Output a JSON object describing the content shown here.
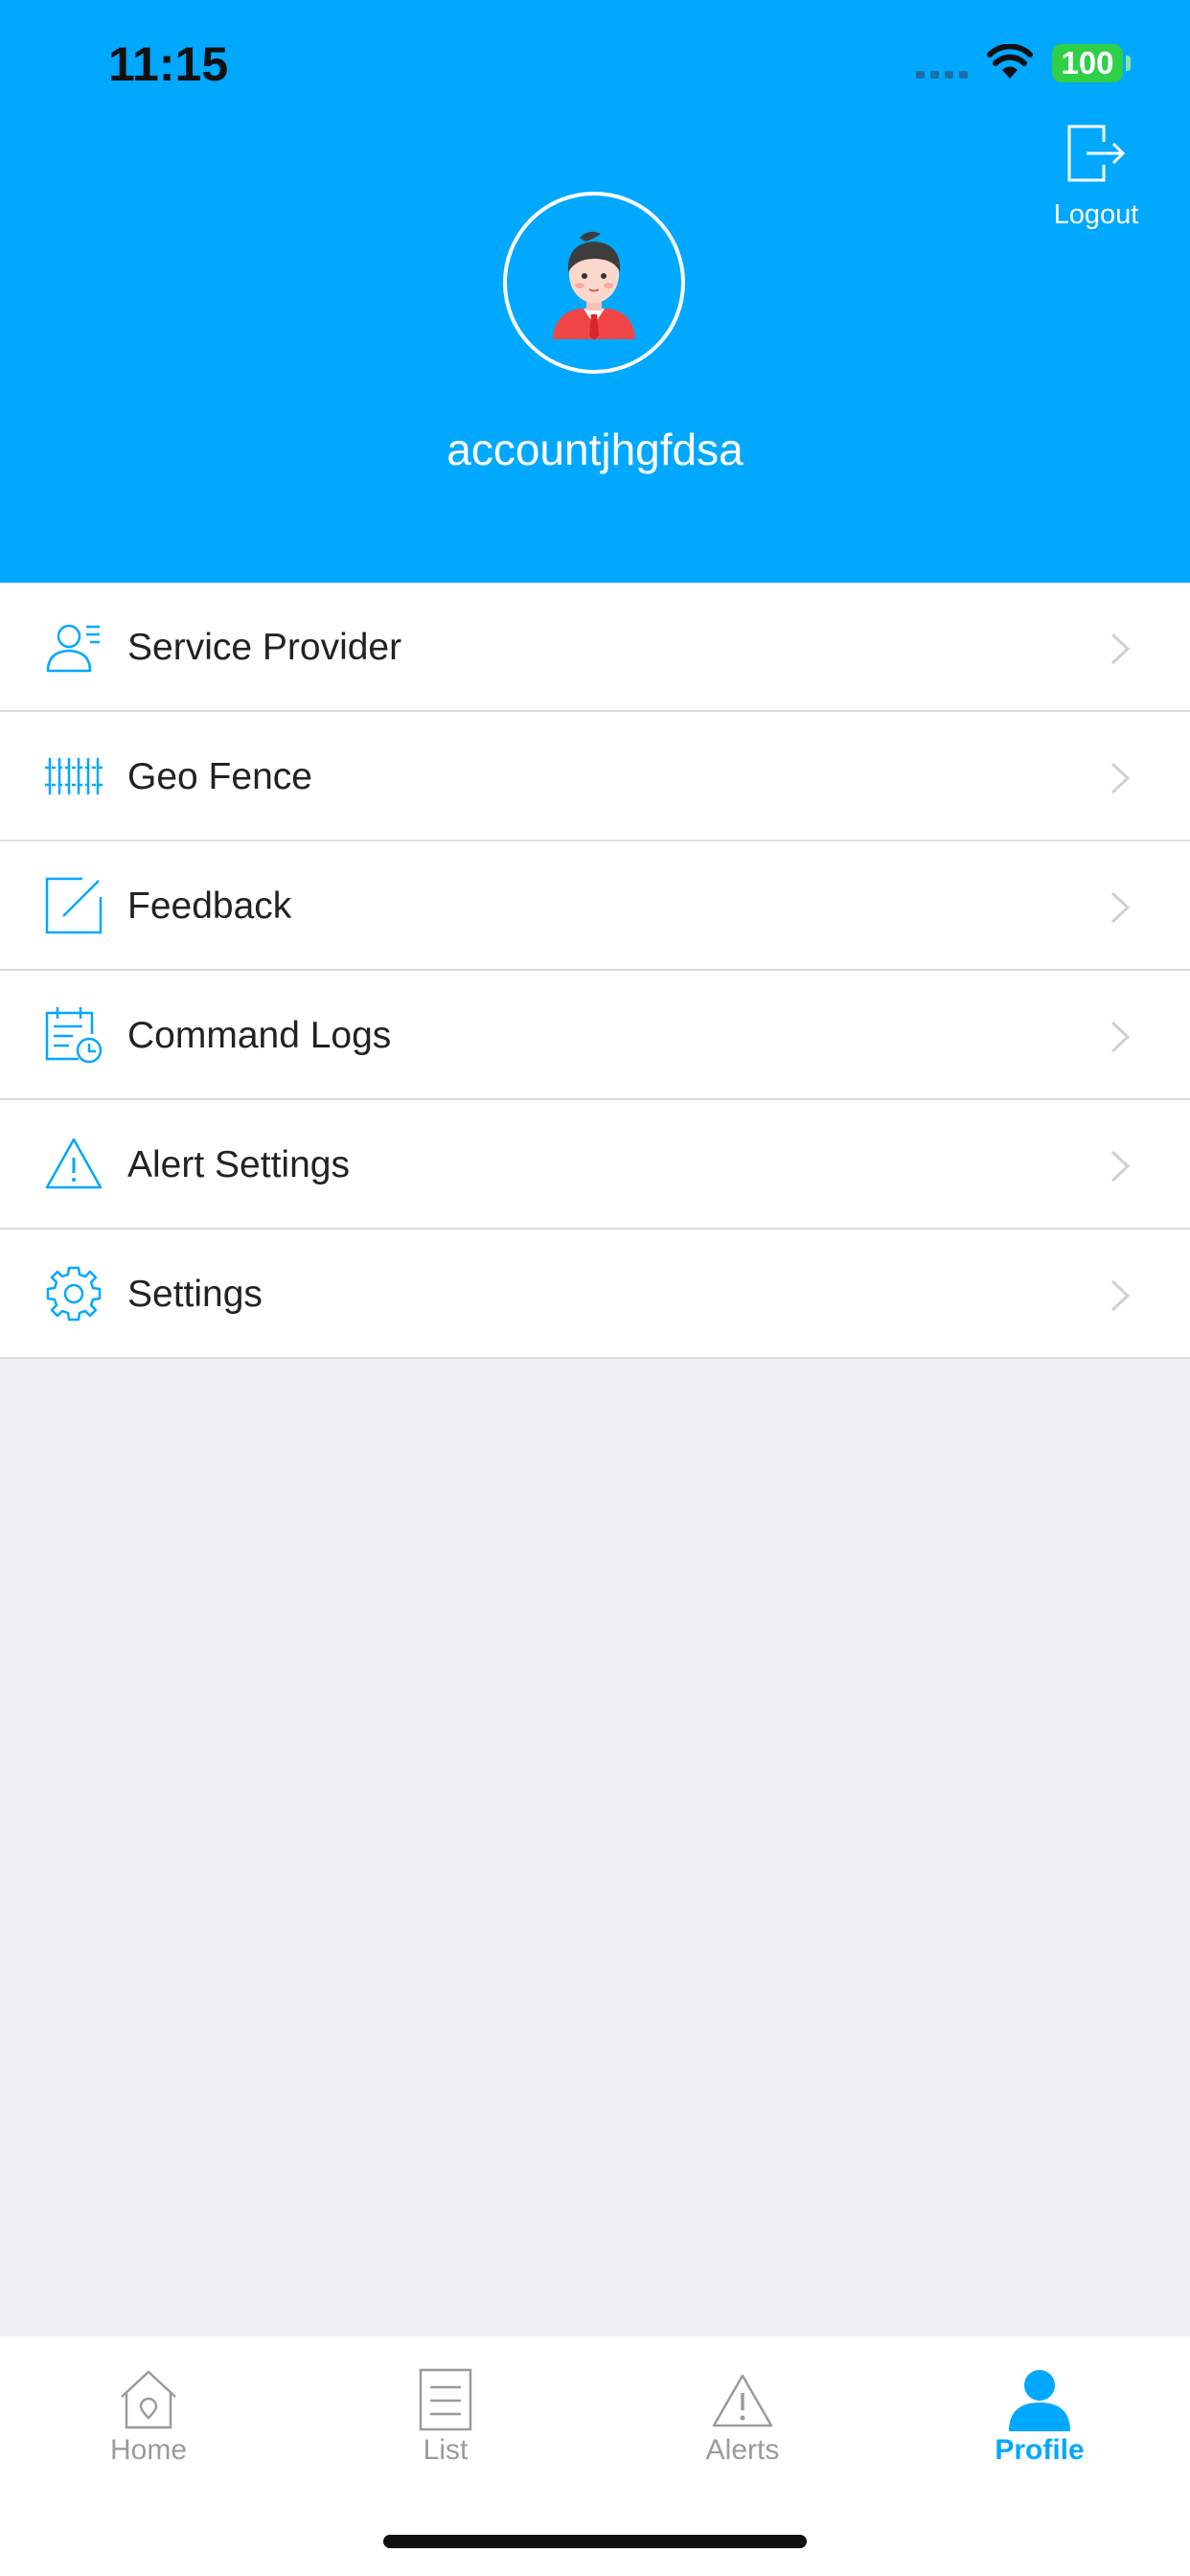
{
  "status_bar": {
    "time": "11:15",
    "battery": "100"
  },
  "header": {
    "logout_label": "Logout",
    "username": "accountjhgfdsa"
  },
  "menu": {
    "items": [
      {
        "label": "Service Provider",
        "icon": "service-provider-icon"
      },
      {
        "label": "Geo Fence",
        "icon": "geo-fence-icon"
      },
      {
        "label": "Feedback",
        "icon": "feedback-icon"
      },
      {
        "label": "Command Logs",
        "icon": "command-logs-icon"
      },
      {
        "label": "Alert Settings",
        "icon": "alert-settings-icon"
      },
      {
        "label": "Settings",
        "icon": "gear-icon"
      }
    ]
  },
  "tabbar": {
    "tabs": [
      {
        "label": "Home",
        "icon": "home-icon",
        "active": false
      },
      {
        "label": "List",
        "icon": "list-icon",
        "active": false
      },
      {
        "label": "Alerts",
        "icon": "alert-icon",
        "active": false
      },
      {
        "label": "Profile",
        "icon": "profile-icon",
        "active": true
      }
    ]
  },
  "colors": {
    "accent": "#00a8ff",
    "background": "#efeff4",
    "battery": "#2fcf48",
    "inactive_tab": "#9b9b9b"
  }
}
